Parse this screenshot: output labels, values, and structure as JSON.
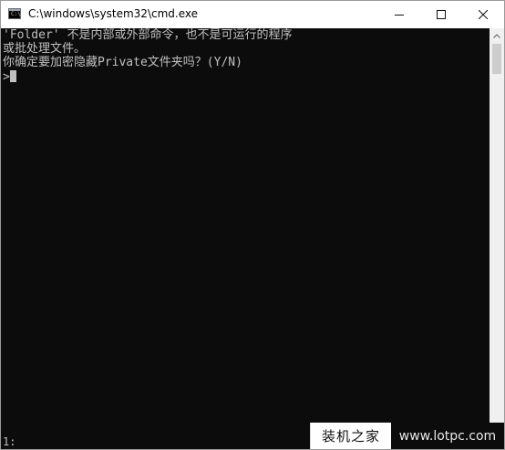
{
  "window": {
    "title": "C:\\windows\\system32\\cmd.exe",
    "icon": "console-app-icon"
  },
  "titlebar_buttons": {
    "minimize": "minimize-icon",
    "maximize": "maximize-icon",
    "close": "close-icon"
  },
  "console": {
    "lines": [
      "'Folder' 不是内部或外部命令，也不是可运行的程序",
      "或批处理文件。",
      "你确定要加密隐藏Private文件夹吗？(Y/N)",
      ">"
    ],
    "status": "1:",
    "background": "#0c0c0c",
    "foreground": "#c0c0c0"
  },
  "watermark": {
    "cn": "装机之家",
    "url": "www.lotpc.com"
  }
}
